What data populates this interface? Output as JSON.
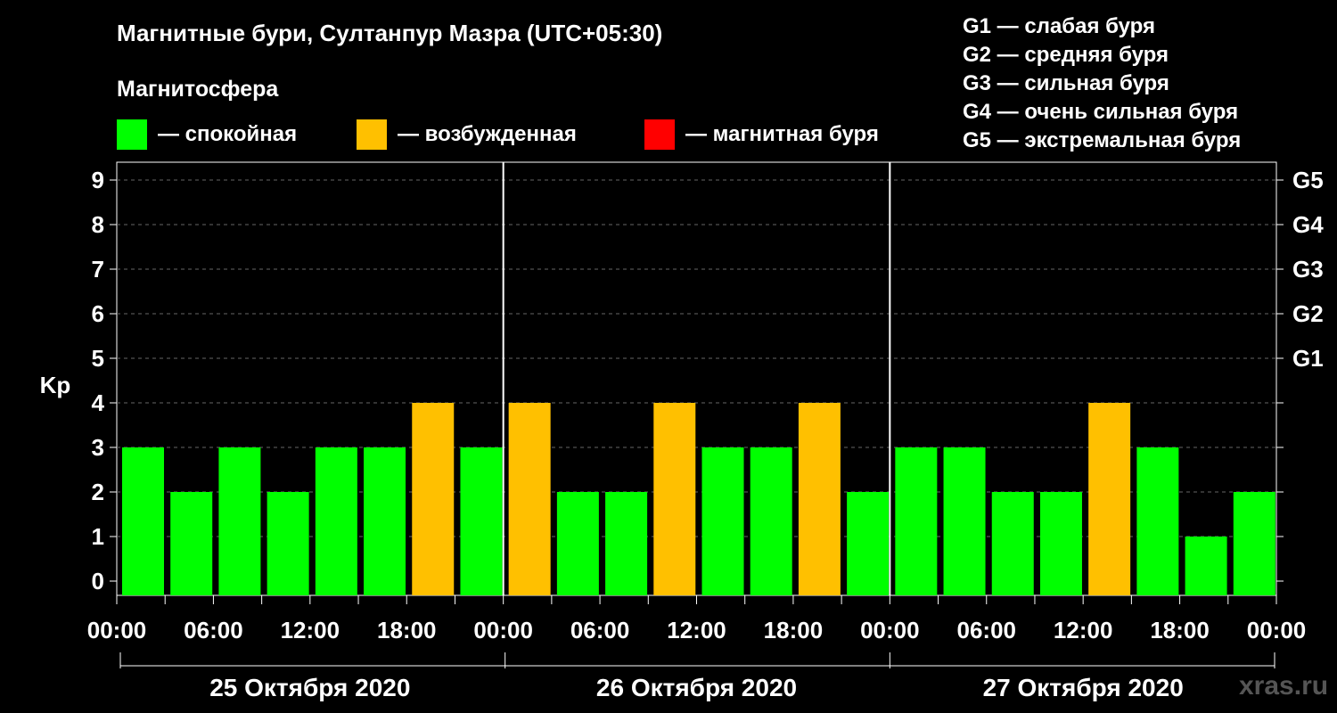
{
  "header": {
    "title": "Магнитные бури, Султанпур Мазра (UTC+05:30)",
    "subtitle": "Магнитосфера"
  },
  "legend": [
    {
      "label": "— спокойная",
      "color": "#00ff00"
    },
    {
      "label": "— возбужденная",
      "color": "#ffc000"
    },
    {
      "label": "— магнитная буря",
      "color": "#ff0000"
    }
  ],
  "g_levels": [
    "G1 — слабая буря",
    "G2 — средняя буря",
    "G3 — сильная буря",
    "G4 — очень сильная буря",
    "G5 — экстремальная буря"
  ],
  "watermark": "xras.ru",
  "chart_data": {
    "type": "bar",
    "ylabel": "Kp",
    "ylim": [
      0,
      9
    ],
    "y_ticks": [
      0,
      1,
      2,
      3,
      4,
      5,
      6,
      7,
      8,
      9
    ],
    "right_axis_labels": [
      {
        "kp": 5,
        "label": "G1"
      },
      {
        "kp": 6,
        "label": "G2"
      },
      {
        "kp": 7,
        "label": "G3"
      },
      {
        "kp": 8,
        "label": "G4"
      },
      {
        "kp": 9,
        "label": "G5"
      }
    ],
    "x_tick_labels": [
      "00:00",
      "06:00",
      "12:00",
      "18:00",
      "00:00",
      "06:00",
      "12:00",
      "18:00",
      "00:00",
      "06:00",
      "12:00",
      "18:00",
      "00:00"
    ],
    "days": [
      "25 Октября 2020",
      "26 Октября 2020",
      "27 Октября 2020"
    ],
    "categories": [
      "25.10 00:00",
      "25.10 03:00",
      "25.10 06:00",
      "25.10 09:00",
      "25.10 12:00",
      "25.10 15:00",
      "25.10 18:00",
      "25.10 21:00",
      "26.10 00:00",
      "26.10 03:00",
      "26.10 06:00",
      "26.10 09:00",
      "26.10 12:00",
      "26.10 15:00",
      "26.10 18:00",
      "26.10 21:00",
      "27.10 00:00",
      "27.10 03:00",
      "27.10 06:00",
      "27.10 09:00",
      "27.10 12:00",
      "27.10 15:00",
      "27.10 18:00",
      "27.10 21:00"
    ],
    "values": [
      3,
      2,
      3,
      2,
      3,
      3,
      4,
      3,
      4,
      2,
      2,
      4,
      3,
      3,
      4,
      2,
      3,
      3,
      2,
      2,
      4,
      3,
      1,
      2
    ],
    "colors": {
      "quiet": "#00ff00",
      "active": "#ffc000",
      "storm": "#ff0000"
    },
    "grid": true
  }
}
